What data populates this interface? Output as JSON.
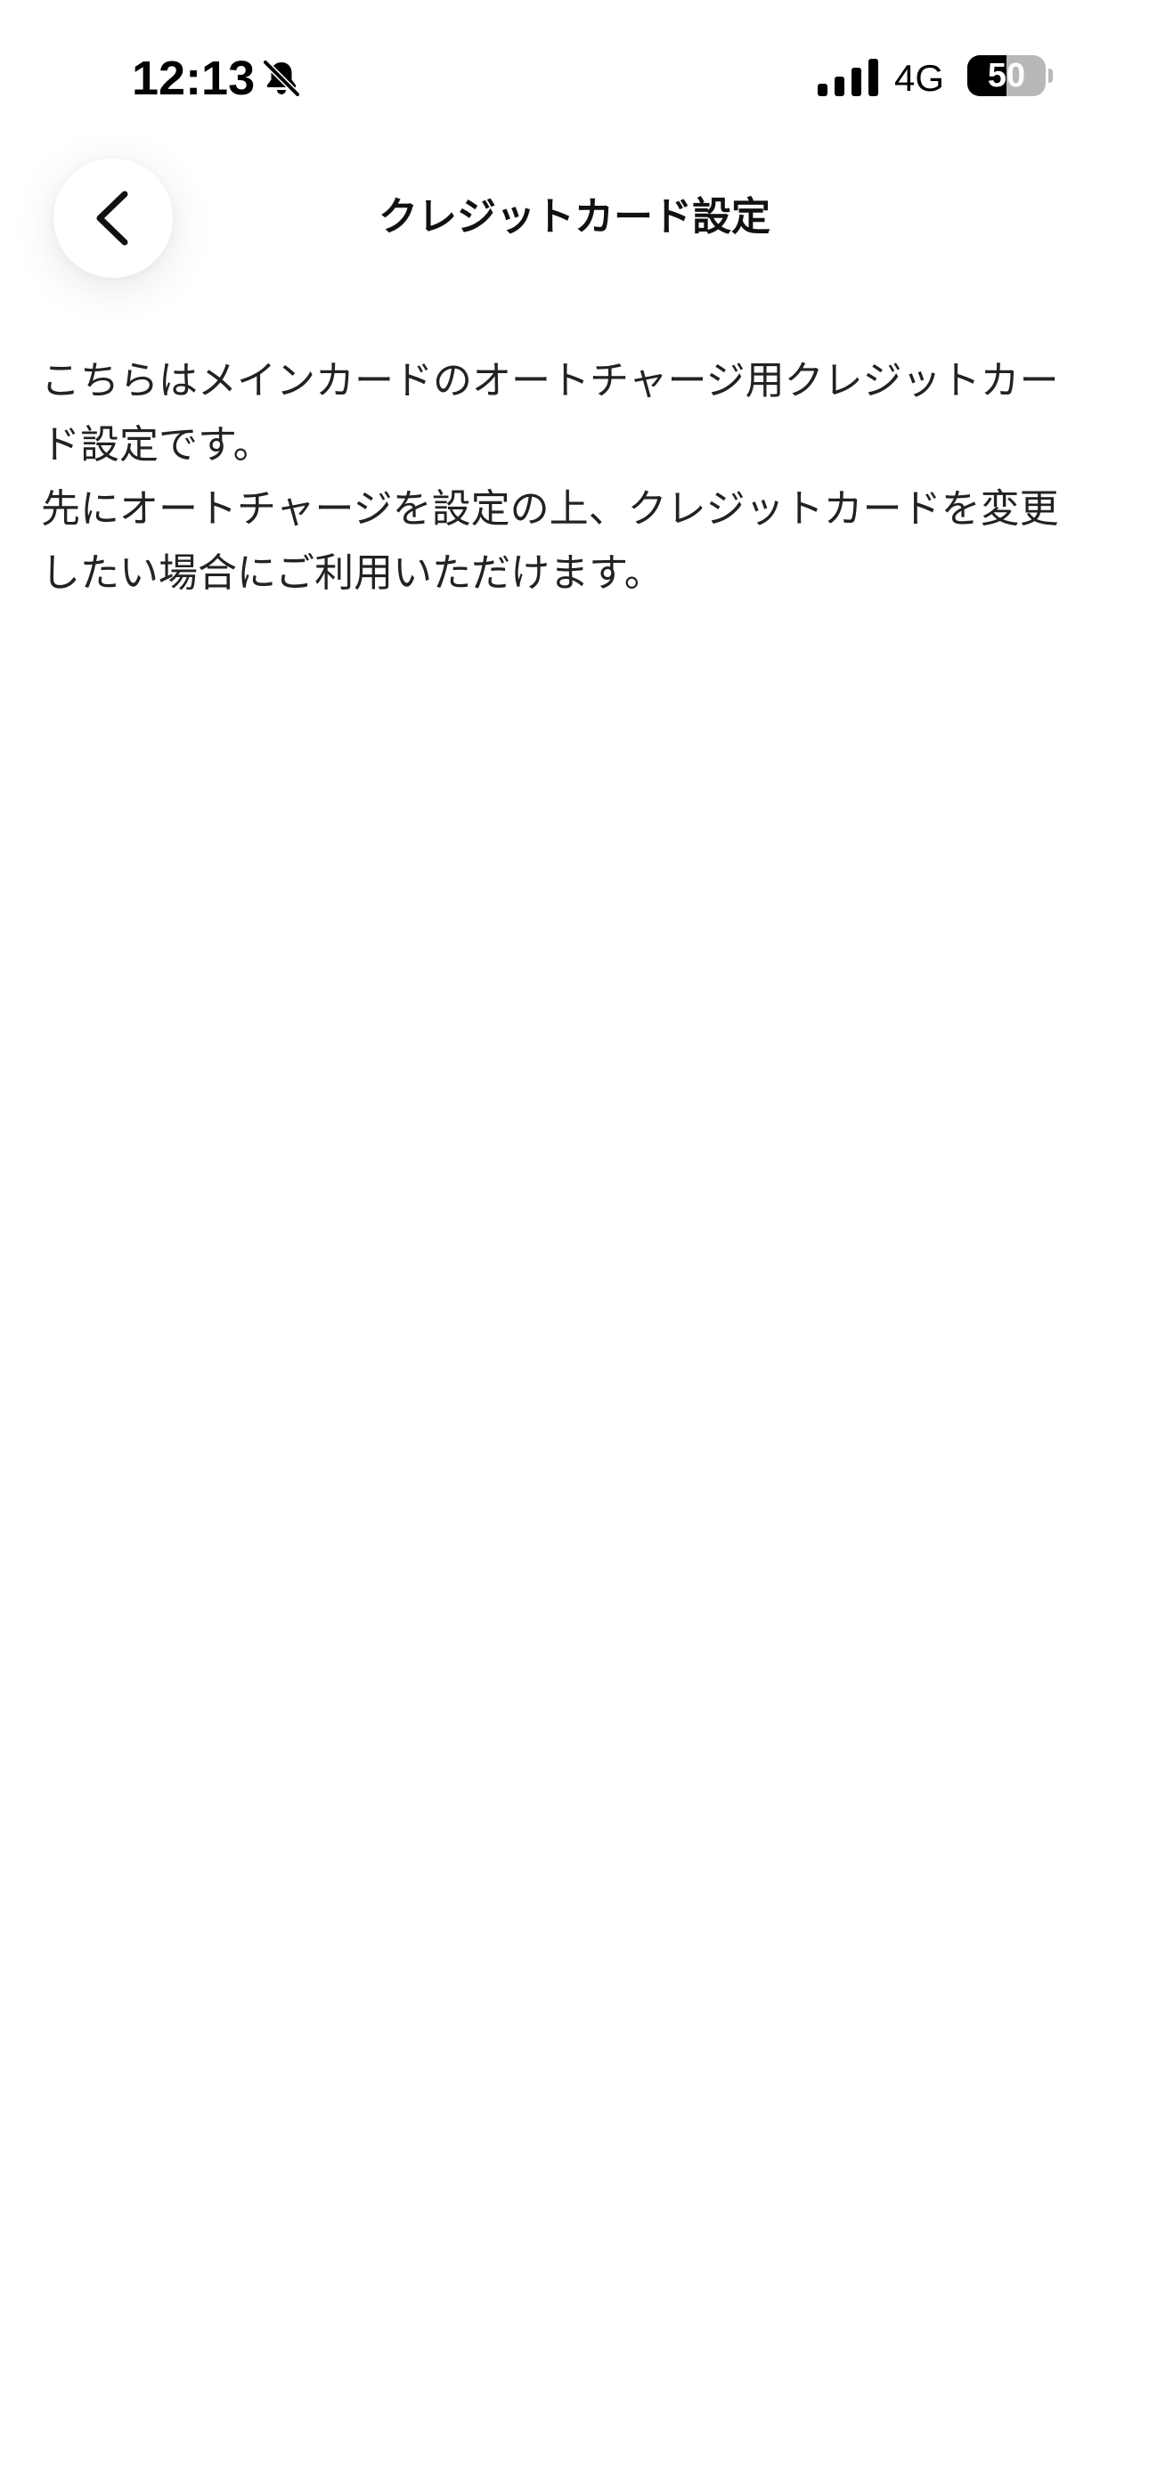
{
  "status_bar": {
    "time": "12:13",
    "network": "4G",
    "battery_level": "50",
    "battery_fraction": 0.5,
    "icons": {
      "silent_mode": "bell-slash-icon",
      "signal": "cellular-signal-icon",
      "battery": "battery-icon"
    }
  },
  "header": {
    "back_icon": "chevron-left-icon",
    "title": "クレジットカード設定"
  },
  "description": {
    "lines": [
      "こちらはメインカードのオートチャージ用クレジットカー",
      "ド設定です。",
      "先にオートチャージを設定の上、クレジットカードを変更",
      "したい場合にご利用いただけます。"
    ]
  },
  "colors": {
    "background": "#ffffff",
    "text": "#222222",
    "title": "#111111"
  }
}
